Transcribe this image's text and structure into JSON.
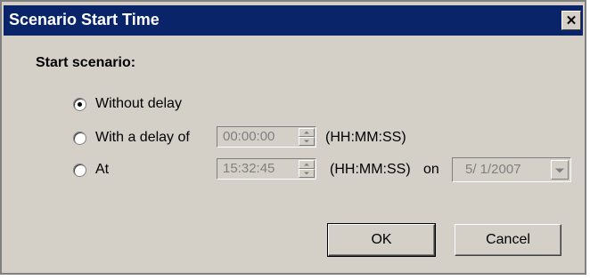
{
  "window": {
    "title": "Scenario Start Time",
    "close_glyph": "✕"
  },
  "group": {
    "label": "Start scenario:"
  },
  "options": [
    {
      "label": "Without delay",
      "checked": true
    },
    {
      "label": "With a delay of",
      "checked": false
    },
    {
      "label": "At",
      "checked": false
    }
  ],
  "delay": {
    "value": "00:00:00",
    "format": "(HH:MM:SS)"
  },
  "at": {
    "value": "15:32:45",
    "format": "(HH:MM:SS)",
    "on_label": "on",
    "date": "5/ 1/2007"
  },
  "buttons": {
    "ok": "OK",
    "cancel": "Cancel"
  },
  "colors": {
    "titlebar": "#0a246a",
    "face": "#d4d0c8",
    "disabled_text": "#808080"
  }
}
